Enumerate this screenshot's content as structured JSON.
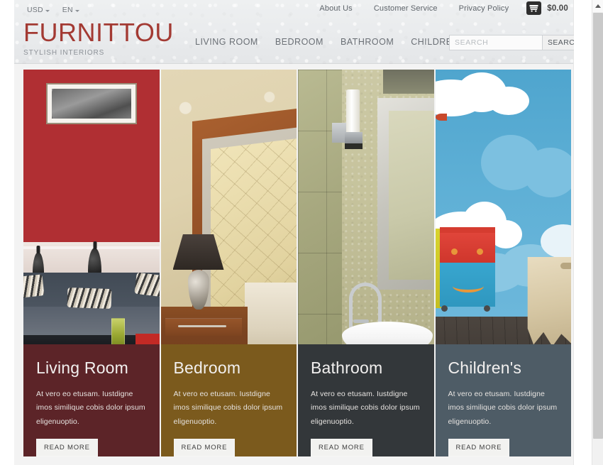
{
  "topbar": {
    "currency": {
      "label": "USD",
      "icon": "chevron-down-icon"
    },
    "language": {
      "label": "EN",
      "icon": "chevron-down-icon"
    },
    "links": [
      {
        "label": "About Us"
      },
      {
        "label": "Customer Service"
      },
      {
        "label": "Privacy Policy"
      }
    ],
    "cart": {
      "icon": "shopping-cart-icon",
      "total": "$0.00"
    }
  },
  "brand": {
    "name": "FURNITTOU",
    "tagline": "STYLISH INTERIORS",
    "color": "#a33a33"
  },
  "nav": {
    "items": [
      {
        "label": "LIVING ROOM"
      },
      {
        "label": "BEDROOM"
      },
      {
        "label": "BATHROOM"
      },
      {
        "label": "CHILDREN ROOM"
      }
    ]
  },
  "search": {
    "placeholder": "SEARCH",
    "value": "",
    "button_label": "SEARCH"
  },
  "categories": [
    {
      "title": "Living Room",
      "description": "At vero eo etusam. Iustdigne imos similique cobis dolor ipsum eligenuoptio.",
      "button_label": "READ MORE",
      "panel_color": "#5c2428",
      "photo_alt": "living-room-photo"
    },
    {
      "title": "Bedroom",
      "description": "At vero eo etusam. Iustdigne imos similique cobis dolor ipsum eligenuoptio.",
      "button_label": "READ MORE",
      "panel_color": "#7b5a1d",
      "photo_alt": "bedroom-photo"
    },
    {
      "title": "Bathroom",
      "description": "At vero eo etusam. Iustdigne imos similique cobis dolor ipsum eligenuoptio.",
      "button_label": "READ MORE",
      "panel_color": "#33373a",
      "photo_alt": "bathroom-photo"
    },
    {
      "title": "Children's",
      "description": "At vero eo etusam. Iustdigne imos similique cobis dolor ipsum eligenuoptio.",
      "button_label": "READ MORE",
      "panel_color": "#4e5c66",
      "photo_alt": "children-room-photo"
    }
  ],
  "scrollbar": {
    "up_icon": "chevron-up-icon"
  }
}
